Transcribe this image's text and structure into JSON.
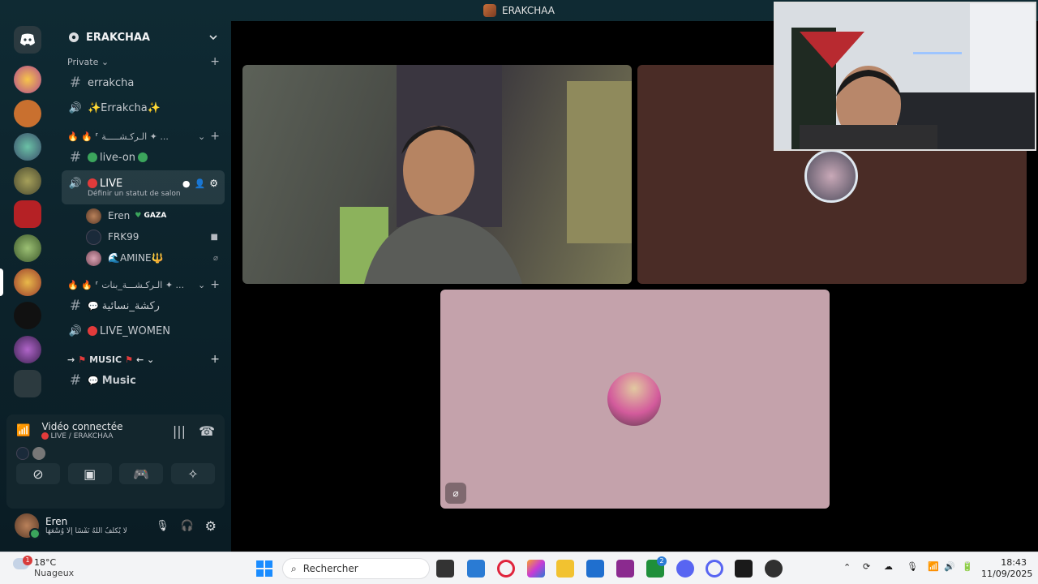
{
  "window": {
    "title": "ERAKCHAA"
  },
  "server": {
    "name": "ERAKCHAA"
  },
  "sidebar": {
    "category_private": "Private ⌄",
    "channels_top": [
      {
        "name": "errakcha",
        "type": "text"
      },
      {
        "name": "✨Errakcha✨",
        "type": "voice"
      }
    ],
    "category_2": "🔥 🔥 ⸢ الـركـشـــــة ✦ ...",
    "channel_live_on": "live-on",
    "active_channel": {
      "name": "LIVE",
      "status": "Définir un statut de salon"
    },
    "voice_users": [
      {
        "name": "Eren",
        "badge": "GAZA"
      },
      {
        "name": "FRK99",
        "badge": ""
      },
      {
        "name": "🌊AMINE🔱",
        "badge": ""
      }
    ],
    "category_3": "🔥 🔥 ⸢ الـركـشـــة_بنات ✦ ...",
    "channel_women_text": "ركشة_نسائية",
    "channel_live_women": "LIVE_WOMEN",
    "category_music": "MUSIC",
    "channel_music": "Music"
  },
  "voice_panel": {
    "title": "Vidéo connectée",
    "subtitle": "LIVE / ERAKCHAA"
  },
  "user_panel": {
    "name": "Eren",
    "status": "لَا يُكَلِّفُ اللَّهُ نَفْسًا إِلَّا وُسْعَهَا"
  },
  "taskbar": {
    "weather_temp": "18°C",
    "weather_desc": "Nuageux",
    "weather_badge": "1",
    "search_placeholder": "Rechercher",
    "time": "18:43",
    "date": "11/09/2025",
    "badge_count": "2"
  },
  "colors": {
    "accent_red": "#e23b3b",
    "online_green": "#3ba55c",
    "tile_brown": "#4a2c26",
    "tile_pink": "#c4a2ab"
  }
}
